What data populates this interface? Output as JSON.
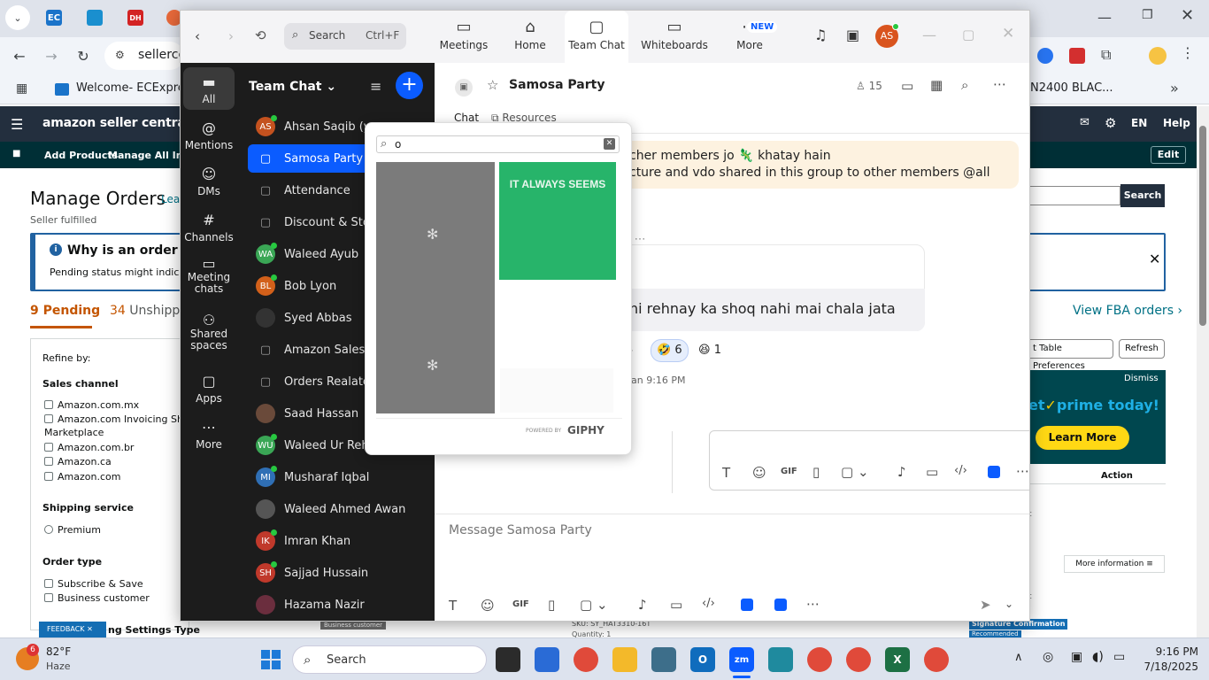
{
  "browser": {
    "address_text": "sellerce",
    "bookmark_label": "Welcome- ECExpres...",
    "right_bookmark": "N2400 BLAC...",
    "tab_badges": [
      "EC",
      "DH"
    ]
  },
  "amazon": {
    "logo": "amazon seller central",
    "nav_items": [
      "Add Products",
      "Manage All Invent"
    ],
    "lang": "EN",
    "help": "Help",
    "edit": "Edit",
    "page_title": "Manage Orders",
    "learn": "Lear",
    "seller_fulfilled": "Seller fulfilled",
    "search_btn": "Search",
    "info_title": "Why is an order pen",
    "info_body": "Pending status might indicate a",
    "tab_pending_count": "9",
    "tab_pending": "Pending",
    "tab_unshipped_count": "34",
    "tab_unshipped": "Unshippe",
    "refine": "Refine by:",
    "sales_channel": "Sales channel",
    "channels": [
      "Amazon.com.mx",
      "Amazon.com Invoicing Shado",
      "Marketplace",
      "Amazon.com.br",
      "Amazon.ca",
      "Amazon.com"
    ],
    "shipping_service": "Shipping service",
    "premium": "Premium",
    "order_type": "Order type",
    "order_types": [
      "Subscribe & Save",
      "Business customer"
    ],
    "settings_type": "ng Settings Type",
    "feedback": "FEEDBACK",
    "view_fba": "View FBA orders",
    "table_prefs": "t Table Preferences",
    "refresh": "Refresh",
    "dismiss": "Dismiss",
    "prime_text": "et",
    "prime_word": "prime today!",
    "learn_more": "Learn More",
    "action": "Action",
    "more_info": "More information",
    "business_customer": "Business customer",
    "sku": "SKU: SY_HAT3310-16T",
    "quantity": "Quantity: 1",
    "sig_confirm": "Signature Confirmation",
    "recommended": "Recommended",
    "row_letter": "t"
  },
  "zoom": {
    "search_label": "Search",
    "search_shortcut": "Ctrl+F",
    "nav": [
      {
        "label": "Meetings",
        "icon": "video-icon"
      },
      {
        "label": "Home",
        "icon": "home-icon"
      },
      {
        "label": "Team Chat",
        "icon": "chat-icon"
      },
      {
        "label": "Whiteboards",
        "icon": "whiteboard-icon"
      },
      {
        "label": "More",
        "icon": "more-icon"
      }
    ],
    "new_badge": "NEW",
    "avatar_initials": "AS",
    "rail": [
      "All",
      "Mentions",
      "DMs",
      "Channels",
      "Meeting chats",
      "Shared spaces",
      "Apps",
      "More"
    ],
    "list_title": "Team Chat",
    "chats": [
      {
        "name": "Ahsan Saqib (yo",
        "initials": "AS",
        "color": "#c4521f",
        "type": "avatar"
      },
      {
        "name": "Samosa Party",
        "type": "lock-selected"
      },
      {
        "name": "Attendance",
        "type": "lock"
      },
      {
        "name": "Discount & Stoc",
        "type": "lock"
      },
      {
        "name": "Waleed Ayub",
        "initials": "WA",
        "color": "#3aa655",
        "type": "avatar"
      },
      {
        "name": "Bob Lyon",
        "initials": "BL",
        "color": "#d2601a",
        "type": "avatar"
      },
      {
        "name": "Syed Abbas",
        "initials": "",
        "color": "#333333",
        "type": "photo"
      },
      {
        "name": "Amazon Sales T",
        "type": "lock"
      },
      {
        "name": "Orders Realated",
        "type": "lock"
      },
      {
        "name": "Saad Hassan",
        "initials": "",
        "color": "#6a4a3a",
        "type": "photo"
      },
      {
        "name": "Waleed Ur Rehm",
        "initials": "WU",
        "color": "#3aa655",
        "type": "avatar"
      },
      {
        "name": "Musharaf Iqbal",
        "initials": "MI",
        "color": "#2f6fb5",
        "type": "avatar"
      },
      {
        "name": "Waleed Ahmed Awan",
        "initials": "",
        "color": "#555555",
        "type": "photo"
      },
      {
        "name": "Imran Khan",
        "initials": "IK",
        "color": "#c0392b",
        "type": "avatar"
      },
      {
        "name": "Sajjad Hussain",
        "initials": "SH",
        "color": "#c0392b",
        "type": "avatar"
      },
      {
        "name": "Hazama Nazir",
        "initials": "",
        "color": "#6b2e3e",
        "type": "photo"
      }
    ],
    "chat_title": "Samosa Party",
    "member_count": "15",
    "tabs": [
      "Chat",
      "Resources"
    ],
    "pinned_line1": "cher members jo 🦎 khatay hain",
    "pinned_line2": "cture and vdo shared in this group to other members @all",
    "message_text": "hi rehnay ka shoq nahi mai chala jata",
    "reactions": [
      {
        "emoji": "🤣",
        "count": "6"
      },
      {
        "emoji": "😆",
        "count": "1"
      }
    ],
    "timestamp": "an 9:16 PM",
    "composer_placeholder": "Message Samosa Party",
    "gif_label": "GIF"
  },
  "giphy": {
    "query": "o",
    "gif_text": "IT ALWAYS SEEMS",
    "powered": "POWERED BY",
    "brand": "GIPHY"
  },
  "taskbar": {
    "weather_badge": "6",
    "temp": "82°F",
    "condition": "Haze",
    "search": "Search",
    "time": "9:16 PM",
    "date": "7/18/2025"
  }
}
